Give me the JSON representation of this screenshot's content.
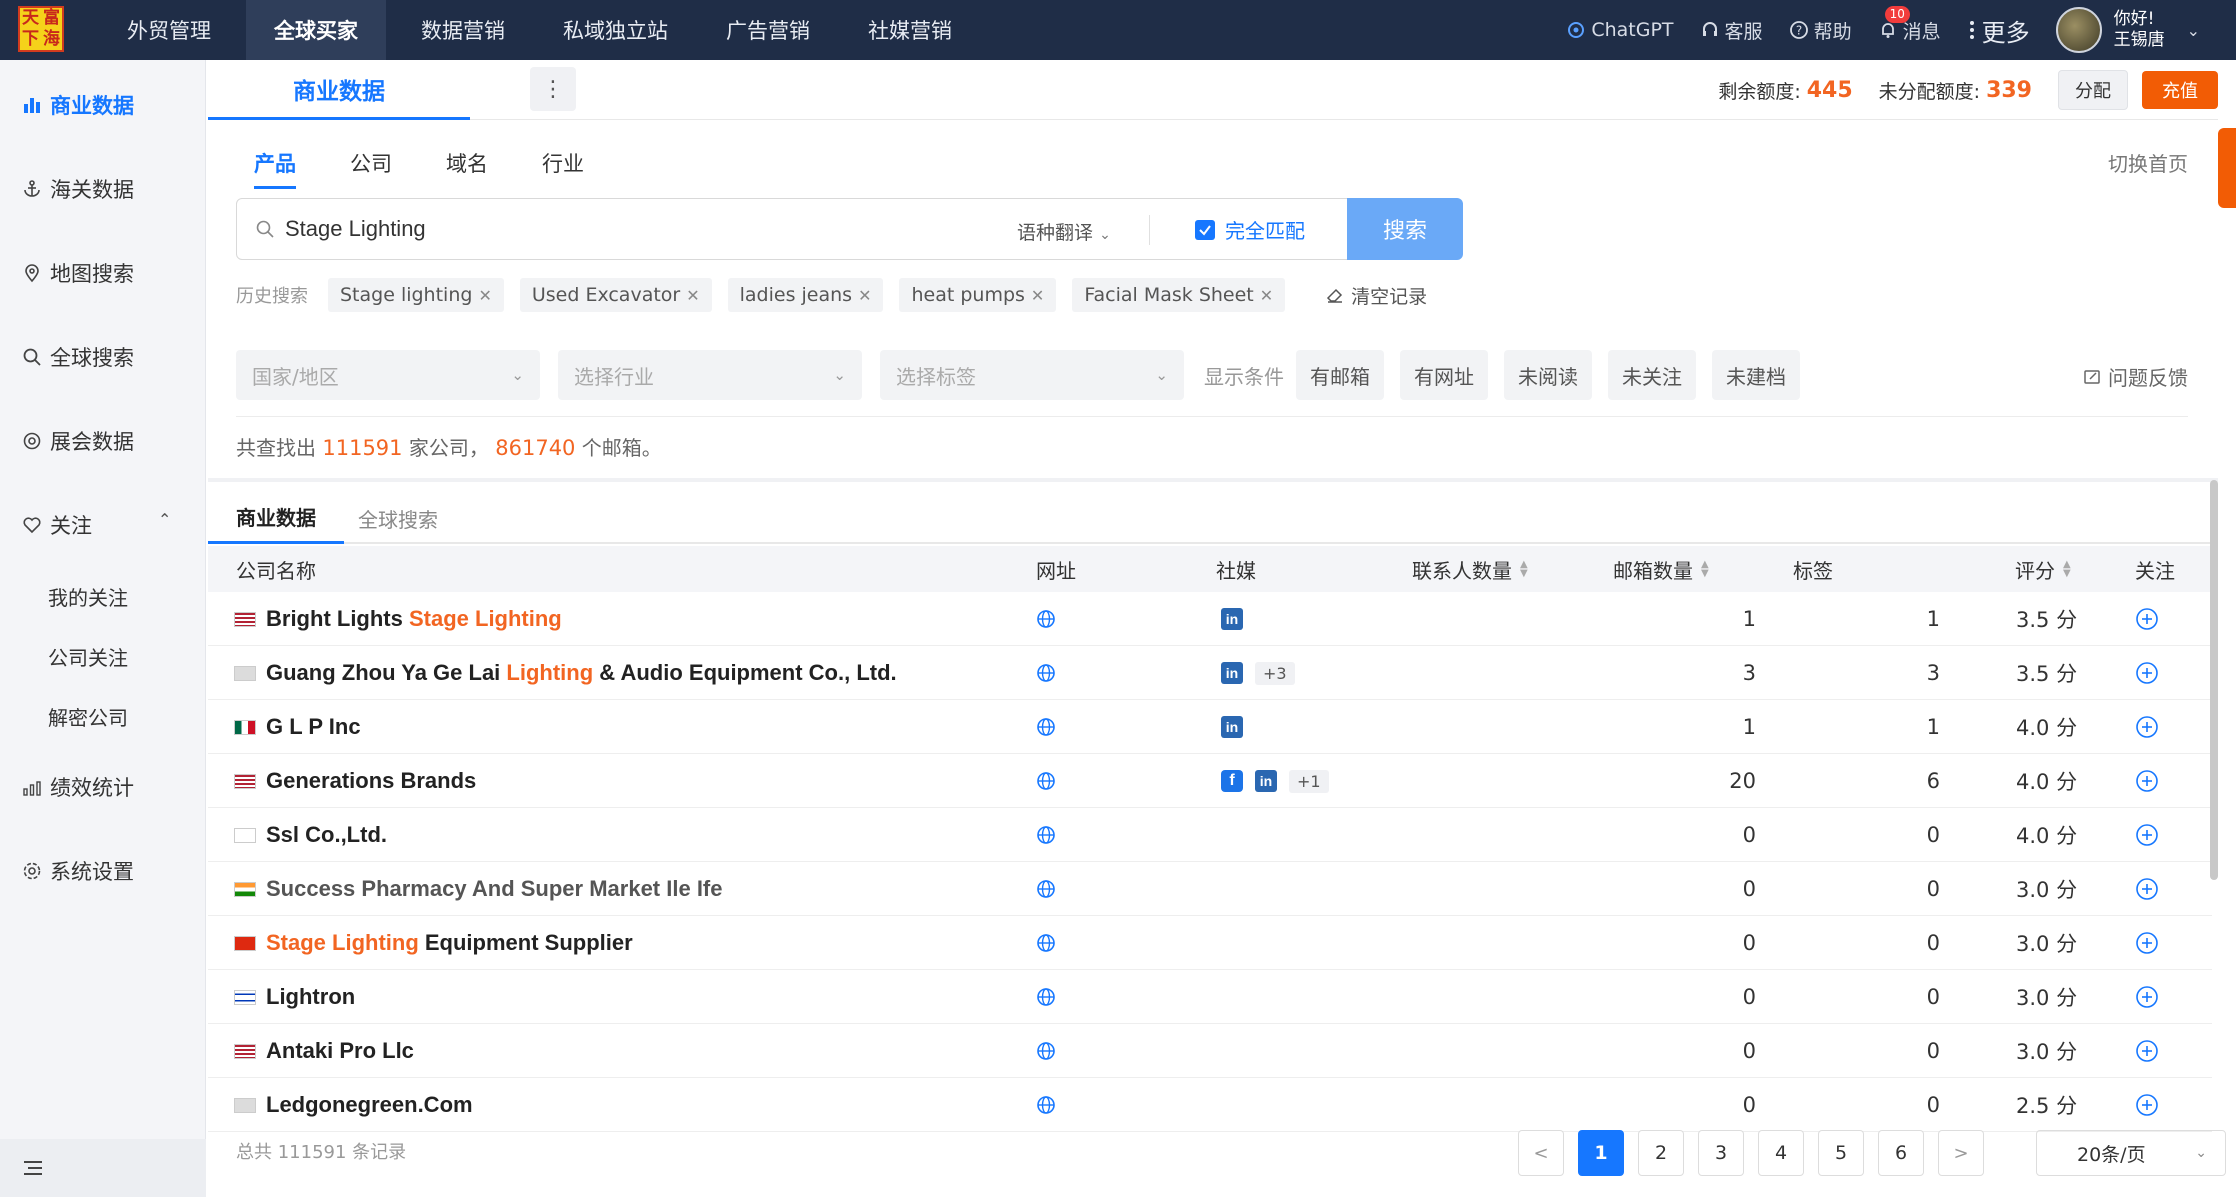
{
  "logo": {
    "chars": [
      "天",
      "富",
      "下",
      "海"
    ]
  },
  "topnav": {
    "items": [
      {
        "label": "外贸管理",
        "active": false
      },
      {
        "label": "全球买家",
        "active": true
      },
      {
        "label": "数据营销",
        "active": false
      },
      {
        "label": "私域独立站",
        "active": false
      },
      {
        "label": "广告营销",
        "active": false
      },
      {
        "label": "社媒营销",
        "active": false
      }
    ]
  },
  "topright": {
    "chatgpt": "ChatGPT",
    "support": "客服",
    "help": "帮助",
    "messages": "消息",
    "message_count": "10",
    "more": "更多",
    "greeting": "你好!",
    "username": "王锡唐"
  },
  "sidebar": {
    "items": [
      {
        "label": "商业数据",
        "icon": "bar-chart-icon"
      },
      {
        "label": "海关数据",
        "icon": "anchor-icon"
      },
      {
        "label": "地图搜索",
        "icon": "map-pin-icon"
      },
      {
        "label": "全球搜索",
        "icon": "search-icon"
      },
      {
        "label": "展会数据",
        "icon": "exhibition-icon"
      },
      {
        "label": "关注",
        "icon": "heart-icon"
      }
    ],
    "follow_sub": [
      "我的关注",
      "公司关注",
      "解密公司"
    ],
    "bottom_items": [
      {
        "label": "绩效统计",
        "icon": "stats-icon"
      },
      {
        "label": "系统设置",
        "icon": "settings-icon"
      }
    ]
  },
  "header": {
    "tab": "商业数据",
    "remaining_label": "剩余额度:",
    "remaining_value": "445",
    "unassigned_label": "未分配额度:",
    "unassigned_value": "339",
    "assign_button": "分配",
    "recharge_button": "充值"
  },
  "subtabs": [
    "产品",
    "公司",
    "域名",
    "行业"
  ],
  "switch_home": "切换首页",
  "search": {
    "value": "Stage Lighting",
    "translate_label": "语种翻译",
    "exact_match_label": "完全匹配",
    "button": "搜索"
  },
  "history": {
    "label": "历史搜索",
    "items": [
      "Stage lighting",
      "Used Excavator",
      "ladies jeans",
      "heat pumps",
      "Facial Mask Sheet"
    ],
    "clear": "清空记录"
  },
  "filters": {
    "country": "国家/地区",
    "industry": "选择行业",
    "tags": "选择标签",
    "conditions_label": "显示条件",
    "conditions": [
      "有邮箱",
      "有网址",
      "未阅读",
      "未关注",
      "未建档"
    ],
    "feedback": "问题反馈"
  },
  "summary": {
    "prefix": "共查找出",
    "companies": "111591",
    "middle": "家公司，",
    "emails": "861740",
    "suffix": "个邮箱。"
  },
  "result_tabs": [
    "商业数据",
    "全球搜索"
  ],
  "table": {
    "headers": {
      "name": "公司名称",
      "website": "网址",
      "social": "社媒",
      "contacts": "联系人数量",
      "emails": "邮箱数量",
      "tags": "标签",
      "rating": "评分",
      "follow": "关注"
    },
    "rows": [
      {
        "flag": "us",
        "parts": [
          "Bright Lights ",
          "Stage Lighting",
          ""
        ],
        "social": [
          "linkedin"
        ],
        "social_more": "",
        "contacts": "1",
        "emails": "1",
        "rating": "3.5 分",
        "muted": false
      },
      {
        "flag": "unknown",
        "parts": [
          "Guang Zhou Ya Ge Lai ",
          "Lighting",
          " & Audio Equipment Co., Ltd."
        ],
        "social": [
          "linkedin"
        ],
        "social_more": "+3",
        "contacts": "3",
        "emails": "3",
        "rating": "3.5 分",
        "muted": false
      },
      {
        "flag": "mx",
        "parts": [
          "G L P Inc",
          "",
          ""
        ],
        "social": [
          "linkedin"
        ],
        "social_more": "",
        "contacts": "1",
        "emails": "1",
        "rating": "4.0 分",
        "muted": false
      },
      {
        "flag": "us",
        "parts": [
          "Generations Brands",
          "",
          ""
        ],
        "social": [
          "facebook",
          "linkedin"
        ],
        "social_more": "+1",
        "contacts": "20",
        "emails": "6",
        "rating": "4.0 分",
        "muted": false
      },
      {
        "flag": "kr",
        "parts": [
          "Ssl Co.,Ltd.",
          "",
          ""
        ],
        "social": [],
        "social_more": "",
        "contacts": "0",
        "emails": "0",
        "rating": "4.0 分",
        "muted": false
      },
      {
        "flag": "in",
        "parts": [
          "Success Pharmacy And Super Market Ile Ife",
          "",
          ""
        ],
        "social": [],
        "social_more": "",
        "contacts": "0",
        "emails": "0",
        "rating": "3.0 分",
        "muted": true
      },
      {
        "flag": "cn",
        "parts": [
          "",
          "Stage Lighting",
          " Equipment Supplier"
        ],
        "social": [],
        "social_more": "",
        "contacts": "0",
        "emails": "0",
        "rating": "3.0 分",
        "muted": false
      },
      {
        "flag": "il",
        "parts": [
          "Lightron",
          "",
          ""
        ],
        "social": [],
        "social_more": "",
        "contacts": "0",
        "emails": "0",
        "rating": "3.0 分",
        "muted": false
      },
      {
        "flag": "us",
        "parts": [
          "Antaki Pro Llc",
          "",
          ""
        ],
        "social": [],
        "social_more": "",
        "contacts": "0",
        "emails": "0",
        "rating": "3.0 分",
        "muted": false
      },
      {
        "flag": "unknown",
        "parts": [
          "Ledgonegreen.Com",
          "",
          ""
        ],
        "social": [],
        "social_more": "",
        "contacts": "0",
        "emails": "0",
        "rating": "2.5 分",
        "muted": false
      }
    ]
  },
  "pagination": {
    "total": "总共 111591 条记录",
    "pages": [
      "1",
      "2",
      "3",
      "4",
      "5",
      "6"
    ],
    "current": "1",
    "page_size": "20条/页"
  },
  "colors": {
    "accent": "#1677ff",
    "highlight": "#f26522",
    "topbar": "#1f2d47",
    "recharge": "#f25c05"
  }
}
